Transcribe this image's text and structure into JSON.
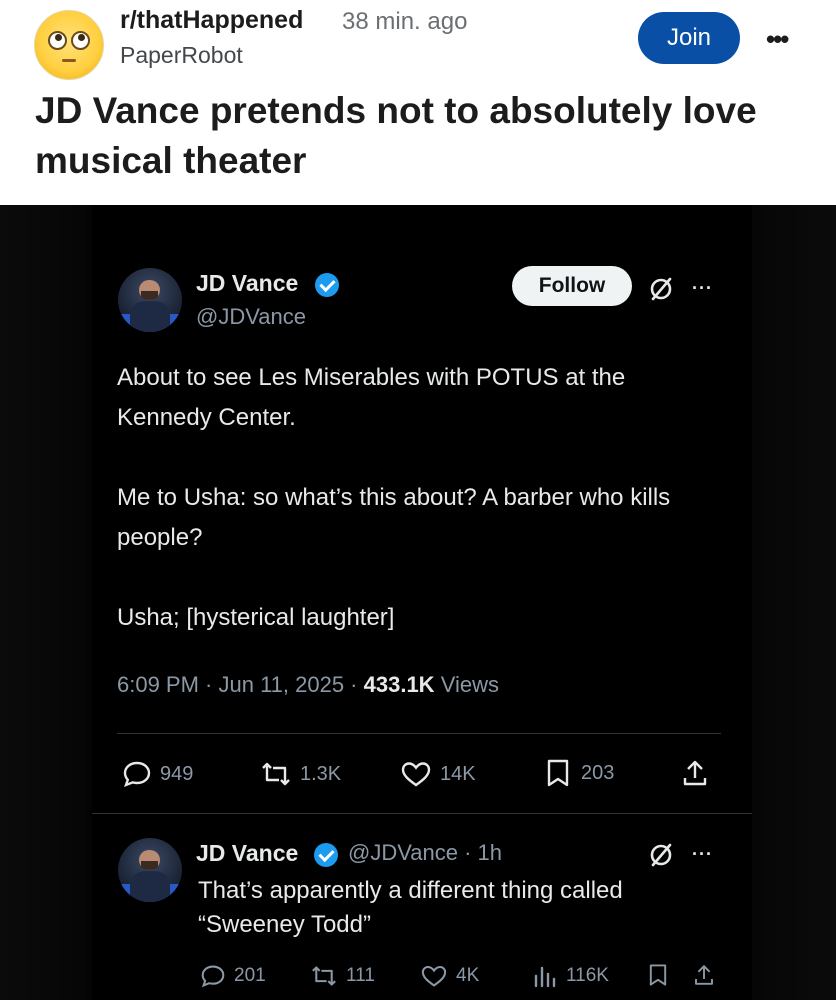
{
  "post": {
    "subreddit": "r/thatHappened",
    "time_ago": "38 min. ago",
    "username": "PaperRobot",
    "join_label": "Join",
    "more_label": "•••",
    "title": "JD Vance pretends not to absolutely love musical theater"
  },
  "tweet": {
    "name": "JD Vance",
    "handle": "@JDVance",
    "follow_label": "Follow",
    "more_label": "···",
    "paragraphs": [
      "About to see Les Miserables with POTUS at the Kennedy Center.",
      "Me to Usha: so what’s this about? A barber who kills people?",
      "Usha; [hysterical laughter]"
    ],
    "time": "6:09 PM · Jun 11, 2025 · ",
    "views_count": "433.1K",
    "views_label": " Views",
    "actions": {
      "replies": "949",
      "reposts": "1.3K",
      "likes": "14K",
      "bookmarks": "203"
    }
  },
  "reply": {
    "name": "JD Vance",
    "handle_time": "@JDVance · 1h",
    "more_label": "···",
    "text": "That’s apparently a different thing called “Sweeney Todd”",
    "actions": {
      "replies": "201",
      "reposts": "111",
      "likes": "4K",
      "views": "116K"
    }
  },
  "colors": {
    "reddit_join": "#0a4fa6",
    "verified_blue": "#1d9bf0",
    "tweet_bg": "#000000",
    "muted_text": "#8b98a5"
  }
}
